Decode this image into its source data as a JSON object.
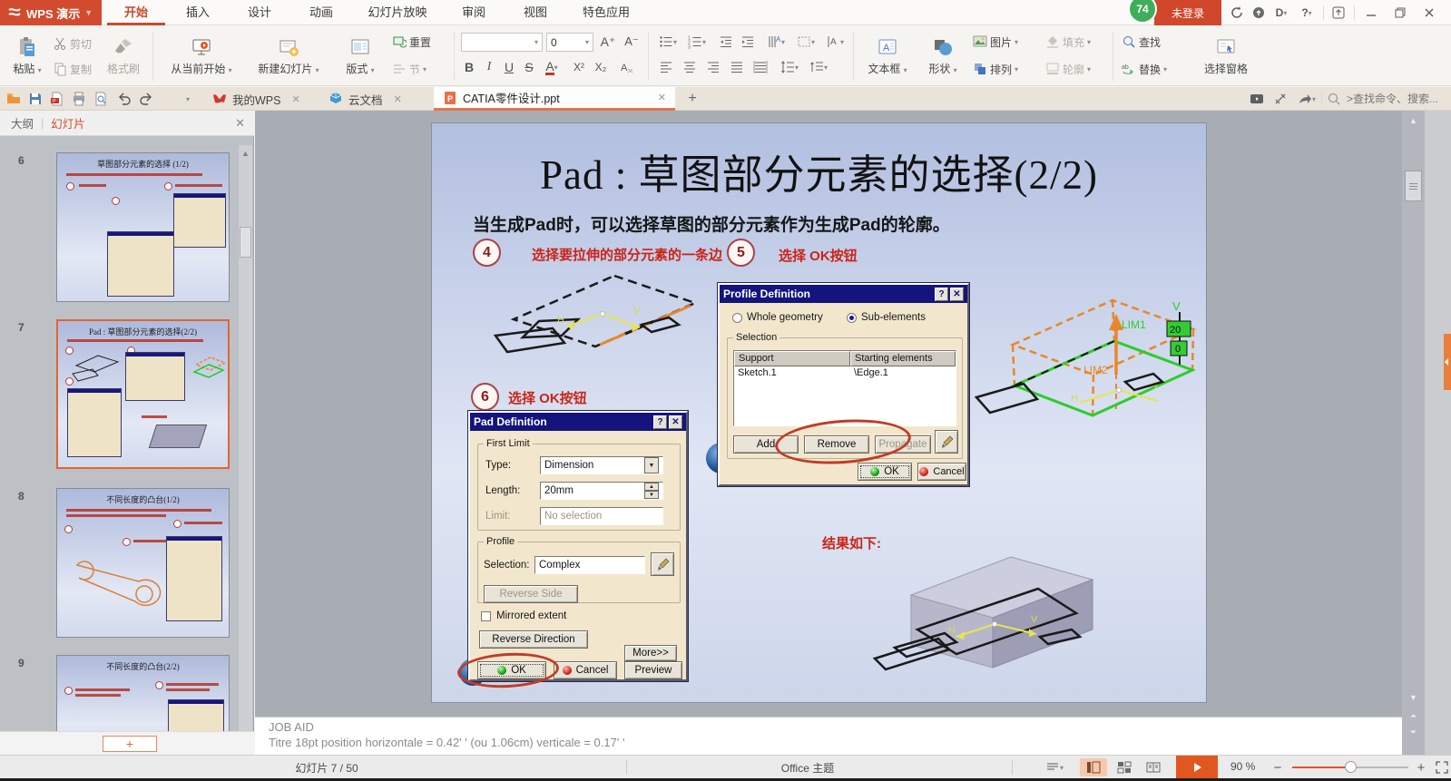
{
  "window": {
    "app_name": "WPS 演示",
    "menu_tabs": [
      "开始",
      "插入",
      "设计",
      "动画",
      "幻灯片放映",
      "审阅",
      "视图",
      "特色应用"
    ],
    "badge": "74",
    "login_text": "未登录"
  },
  "ribbon": {
    "paste": "粘贴",
    "cut": "剪切",
    "copy": "复制",
    "format_painter": "格式刷",
    "from_current": "从当前开始",
    "new_slide": "新建幻灯片",
    "layout": "版式",
    "reset": "重置",
    "section": "节",
    "font_name": "",
    "font_size": "0",
    "bold": "B",
    "italic": "I",
    "underline": "U",
    "strike": "S",
    "sup": "X²",
    "sub": "X₂",
    "textbox": "文本框",
    "shapes": "形状",
    "picture": "图片",
    "arrange": "排列",
    "fill": "填充",
    "outline": "轮廓",
    "find": "查找",
    "replace": "替换",
    "selection_pane": "选择窗格"
  },
  "doctabs": {
    "tabs": [
      {
        "label": "我的WPS"
      },
      {
        "label": "云文档"
      },
      {
        "label": "CATIA零件设计.ppt"
      }
    ],
    "search_placeholder": ">查找命令、搜索..."
  },
  "sidebar": {
    "outline_tab": "大纲",
    "slides_tab": "幻灯片",
    "thumbnails": [
      {
        "num": "6",
        "title": "草图部分元素的选择 (1/2)"
      },
      {
        "num": "7",
        "title": "Pad : 草图部分元素的选择(2/2)"
      },
      {
        "num": "8",
        "title": "不同长度的凸台(1/2)"
      },
      {
        "num": "9",
        "title": "不同长度的凸台(2/2)"
      }
    ]
  },
  "slide": {
    "title": "Pad : 草图部分元素的选择(2/2)",
    "body": "当生成Pad时，可以选择草图的部分元素作为生成Pad的轮廓。",
    "callouts": [
      {
        "num": "4",
        "label": "选择要拉伸的部分元素的一条边"
      },
      {
        "num": "5",
        "label": "选择 OK按钮"
      },
      {
        "num": "6",
        "label": "选择 OK按钮"
      }
    ],
    "result_label": "结果如下:",
    "annotations": {
      "lim1": "LIM1",
      "lim2": "LIM2",
      "dim20": "20",
      "dim0": "0",
      "v": "V",
      "h": "H"
    }
  },
  "profile_dialog": {
    "title": "Profile Definition",
    "radio_whole": "Whole geometry",
    "radio_sub": "Sub-elements",
    "group_selection": "Selection",
    "table": {
      "headers": [
        "Support",
        "Starting elements"
      ],
      "rows": [
        [
          "Sketch.1",
          "\\Edge.1"
        ]
      ]
    },
    "btn_add": "Add",
    "btn_remove": "Remove",
    "btn_propagate": "Propagate",
    "btn_ok": "OK",
    "btn_cancel": "Cancel"
  },
  "pad_dialog": {
    "title": "Pad Definition",
    "group_first_limit": "First Limit",
    "type_label": "Type:",
    "type_value": "Dimension",
    "length_label": "Length:",
    "length_value": "20mm",
    "limit_label": "Limit:",
    "limit_value": "No selection",
    "group_profile": "Profile",
    "selection_label": "Selection:",
    "selection_value": "Complex",
    "btn_reverse_side": "Reverse Side",
    "chk_mirrored": "Mirrored extent",
    "btn_reverse_direction": "Reverse Direction",
    "btn_more": "More>>",
    "btn_ok": "OK",
    "btn_cancel": "Cancel",
    "btn_preview": "Preview"
  },
  "notes": {
    "line1": "JOB AID",
    "line2": "Titre 18pt position horizontale  = 0.42'  '   (ou 1.06cm) verticale  = 0.17'  '"
  },
  "statusbar": {
    "slide_info": "幻灯片 7 / 50",
    "theme": "Office 主题",
    "zoom": "90 %"
  }
}
